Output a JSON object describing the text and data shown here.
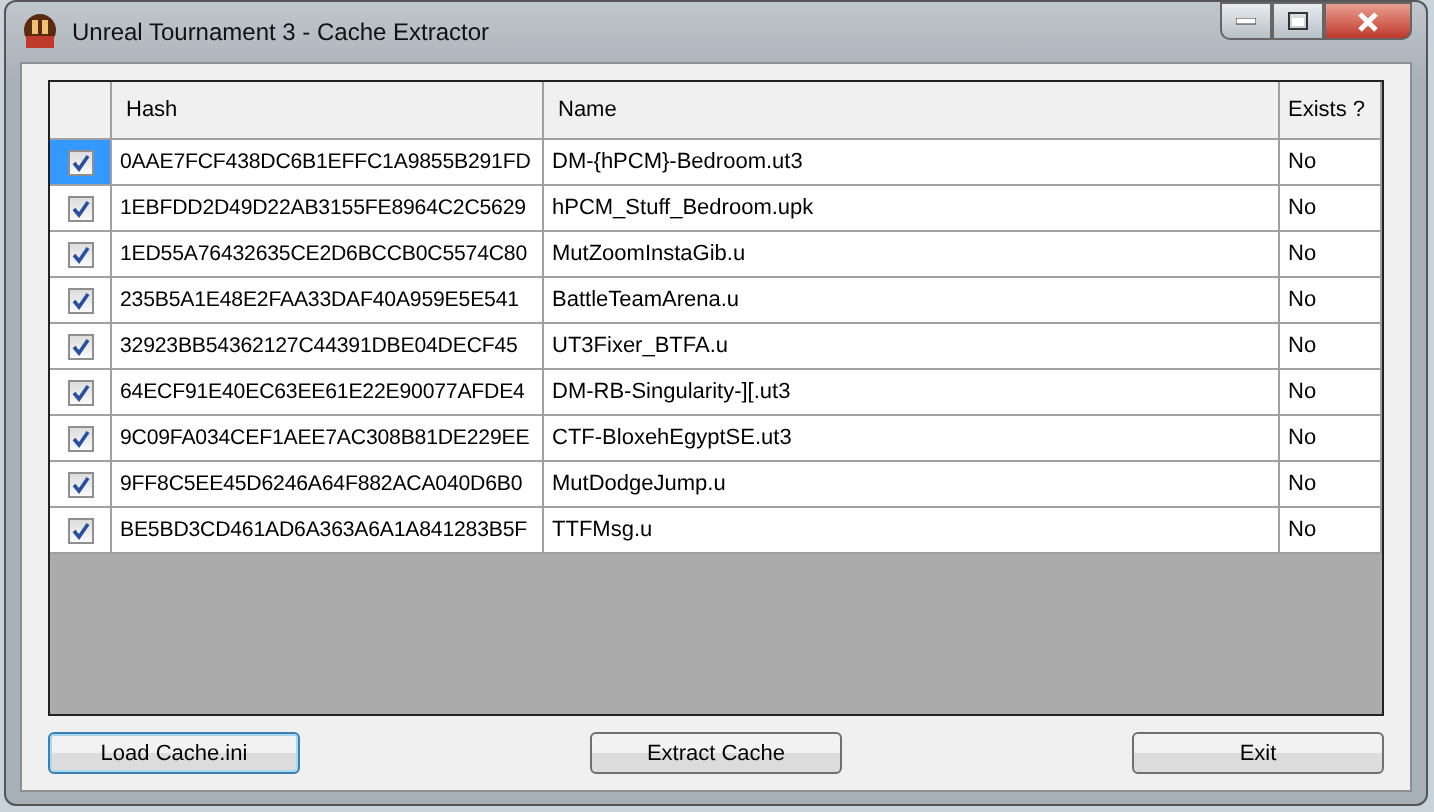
{
  "window": {
    "title": "Unreal Tournament 3 - Cache Extractor"
  },
  "table": {
    "columns": [
      "Hash",
      "Name",
      "Exists ?"
    ],
    "rows": [
      {
        "checked": true,
        "selected": true,
        "hash": "0AAE7FCF438DC6B1EFFC1A9855B291FD",
        "name": "DM-{hPCM}-Bedroom.ut3",
        "exists": "No"
      },
      {
        "checked": true,
        "selected": false,
        "hash": "1EBFDD2D49D22AB3155FE8964C2C5629",
        "name": "hPCM_Stuff_Bedroom.upk",
        "exists": "No"
      },
      {
        "checked": true,
        "selected": false,
        "hash": "1ED55A76432635CE2D6BCCB0C5574C80",
        "name": "MutZoomInstaGib.u",
        "exists": "No"
      },
      {
        "checked": true,
        "selected": false,
        "hash": "235B5A1E48E2FAA33DAF40A959E5E541",
        "name": "BattleTeamArena.u",
        "exists": "No"
      },
      {
        "checked": true,
        "selected": false,
        "hash": "32923BB54362127C44391DBE04DECF45",
        "name": "UT3Fixer_BTFA.u",
        "exists": "No"
      },
      {
        "checked": true,
        "selected": false,
        "hash": "64ECF91E40EC63EE61E22E90077AFDE4",
        "name": "DM-RB-Singularity-][.ut3",
        "exists": "No"
      },
      {
        "checked": true,
        "selected": false,
        "hash": "9C09FA034CEF1AEE7AC308B81DE229EE",
        "name": "CTF-BloxehEgyptSE.ut3",
        "exists": "No"
      },
      {
        "checked": true,
        "selected": false,
        "hash": "9FF8C5EE45D6246A64F882ACA040D6B0",
        "name": "MutDodgeJump.u",
        "exists": "No"
      },
      {
        "checked": true,
        "selected": false,
        "hash": "BE5BD3CD461AD6A363A6A1A841283B5F",
        "name": "TTFMsg.u",
        "exists": "No"
      }
    ]
  },
  "buttons": [
    {
      "label": "Load Cache.ini",
      "focused": true
    },
    {
      "label": "Extract Cache",
      "focused": false
    },
    {
      "label": "Exit",
      "focused": false
    }
  ]
}
